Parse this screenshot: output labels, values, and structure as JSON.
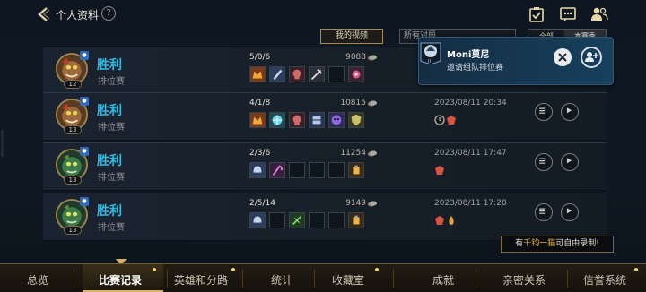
{
  "header": {
    "title": "个人资料",
    "help": "?"
  },
  "filters": {
    "my_videos": "我的视频",
    "mode_select": "所有对局",
    "toggle_a": "全部",
    "toggle_b": "本赛季"
  },
  "matches": [
    {
      "result": "胜利",
      "queue": "排位赛",
      "level": "12",
      "kda": "5/0/6",
      "gold": "9088",
      "date": ""
    },
    {
      "result": "胜利",
      "queue": "排位赛",
      "level": "13",
      "kda": "4/1/8",
      "gold": "10815",
      "date": "2023/08/11 20:34"
    },
    {
      "result": "胜利",
      "queue": "排位赛",
      "level": "13",
      "kda": "2/3/6",
      "gold": "11254",
      "date": "2023/08/11 17:47"
    },
    {
      "result": "胜利",
      "queue": "排位赛",
      "level": "13",
      "kda": "2/5/14",
      "gold": "9149",
      "date": "2023/08/11 17:28"
    }
  ],
  "invite_toast": {
    "name": "Moni莫尼",
    "message": "邀请组队排位赛",
    "tag": "II"
  },
  "tooltip": {
    "prefix": "有",
    "highlight": "千钧一猫",
    "suffix": "可自由录制!"
  },
  "bottom_nav": [
    {
      "label": "总览"
    },
    {
      "label": "比赛记录"
    },
    {
      "label": "英雄和分路"
    },
    {
      "label": "统计"
    },
    {
      "label": "收藏室"
    },
    {
      "label": "成就"
    },
    {
      "label": "亲密关系"
    },
    {
      "label": "信誉系统"
    }
  ],
  "colors": {
    "win": "#2ebbe3",
    "gold_accent": "#d6b264",
    "highlight": "#e3b64a"
  }
}
